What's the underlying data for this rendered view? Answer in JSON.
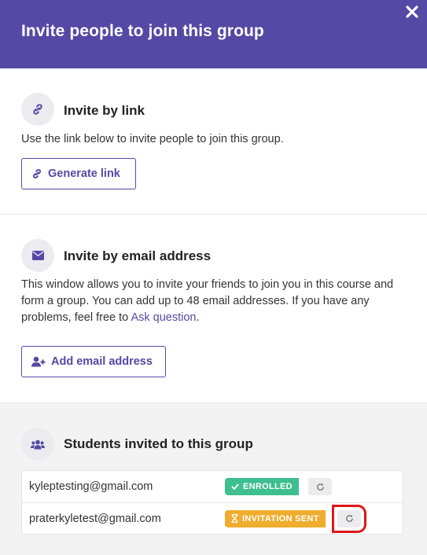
{
  "header": {
    "title": "Invite people to join this group"
  },
  "invite_link": {
    "title": "Invite by link",
    "description": "Use the link below to invite people to join this group.",
    "button_label": "Generate link"
  },
  "invite_email": {
    "title": "Invite by email address",
    "description_prefix": "This window allows you to invite your friends to join you in this course and form a group. You can add up to 48 email addresses. If you have any problems, feel free to ",
    "link_text": "Ask question",
    "description_suffix": ".",
    "button_label": "Add email address"
  },
  "students": {
    "title": "Students invited to this group",
    "rows": [
      {
        "email": "kyleptesting@gmail.com",
        "status": "ENROLLED"
      },
      {
        "email": "praterkyletest@gmail.com",
        "status": "INVITATION SENT"
      }
    ]
  },
  "colors": {
    "primary": "#5449a4",
    "enrolled": "#3dbf8f",
    "sent": "#f0ad2d",
    "highlight": "#e0161b"
  }
}
